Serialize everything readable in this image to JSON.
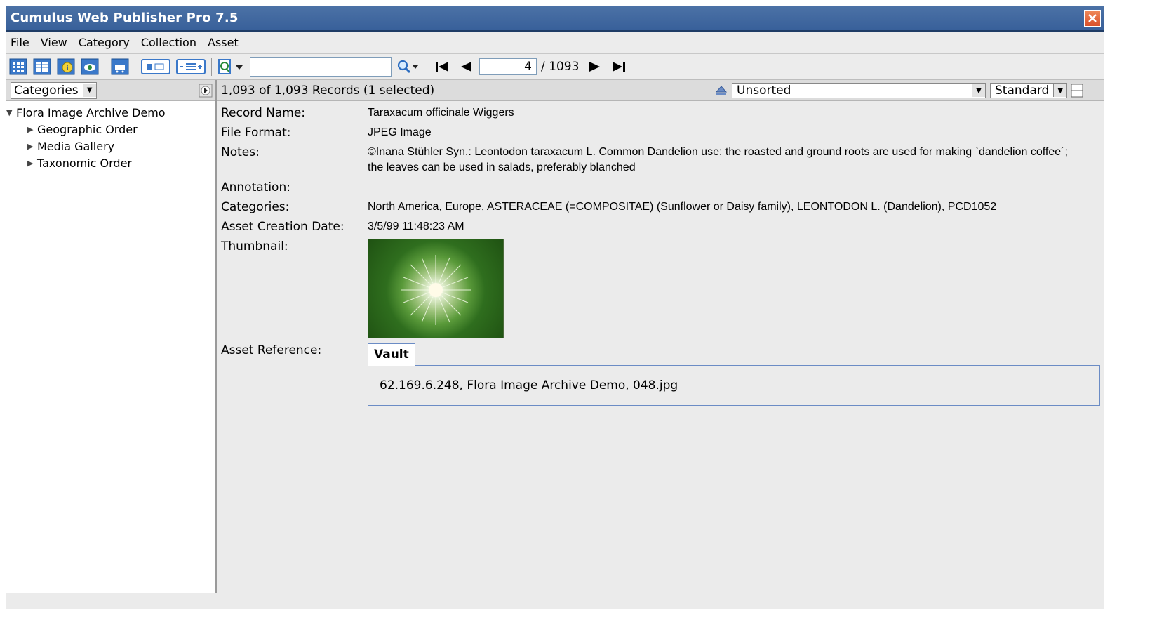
{
  "window": {
    "title": "Cumulus Web Publisher Pro 7.5"
  },
  "menu": [
    "File",
    "View",
    "Category",
    "Collection",
    "Asset"
  ],
  "toolbar": {
    "search_value": "",
    "current_page": "4",
    "total_pages": "/ 1093"
  },
  "left_panel": {
    "selector_label": "Categories",
    "tree": {
      "root": "Flora Image Archive Demo",
      "children": [
        "Geographic Order",
        "Media Gallery",
        "Taxonomic Order"
      ]
    }
  },
  "records_bar": {
    "count_text": "1,093 of 1,093 Records (1 selected)",
    "sort_value": "Unsorted",
    "view_value": "Standard"
  },
  "record": {
    "record_name_label": "Record Name:",
    "record_name": "Taraxacum officinale Wiggers",
    "file_format_label": "File Format:",
    "file_format": "JPEG Image",
    "notes_label": "Notes:",
    "notes": "©Inana Stühler Syn.: Leontodon taraxacum L. Common Dandelion use: the roasted and ground roots are used for making `dandelion coffee´; the leaves can be used in salads, preferably blanched",
    "annotation_label": "Annotation:",
    "annotation": "",
    "categories_label": "Categories:",
    "categories": "North America, Europe, ASTERACEAE (=COMPOSITAE) (Sunflower or Daisy family), LEONTODON L. (Dandelion), PCD1052",
    "creation_date_label": "Asset Creation Date:",
    "creation_date": "3/5/99 11:48:23 AM",
    "thumbnail_label": "Thumbnail:",
    "asset_reference_label": "Asset Reference:",
    "vault_tab": "Vault",
    "vault_value": "62.169.6.248, Flora Image Archive Demo, 048.jpg"
  }
}
